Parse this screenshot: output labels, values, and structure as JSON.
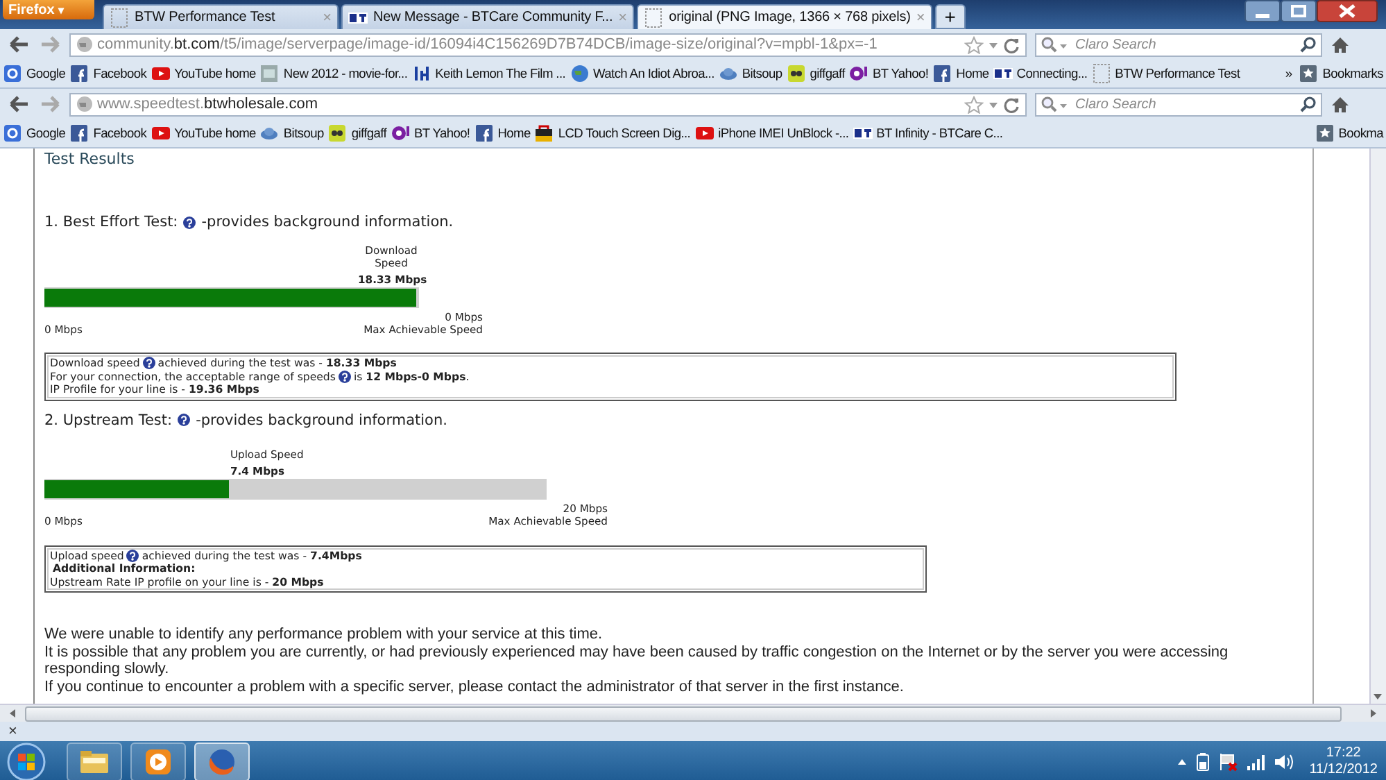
{
  "browser": {
    "menu_button": "Firefox",
    "menu_arrow": "▾",
    "tabs": [
      {
        "title": "BTW Performance Test",
        "close": "×",
        "selected": false
      },
      {
        "title": "New Message - BTCare Community F...",
        "close": "×",
        "selected": false
      },
      {
        "title": "original (PNG Image, 1366 × 768 pixels)",
        "close": "×",
        "selected": true
      }
    ],
    "new_tab": "+"
  },
  "toolbars": [
    {
      "url": "community.**bt.com**/t5/image/serverpage/image-id/16094i4C156269D7B74DCB/image-size/original?v=mpbl-1&px=-1",
      "search_placeholder": "Claro Search",
      "overflow": "»",
      "bookmarks_menu": "Bookmarks",
      "bookmarks": [
        {
          "label": "Google"
        },
        {
          "label": "Facebook"
        },
        {
          "label": "YouTube home"
        },
        {
          "label": "New 2012 - movie-for..."
        },
        {
          "label": "Keith Lemon The Film ..."
        },
        {
          "label": "Watch An Idiot Abroa..."
        },
        {
          "label": "Bitsoup"
        },
        {
          "label": "giffgaff"
        },
        {
          "label": "BT Yahoo!"
        },
        {
          "label": "Home"
        },
        {
          "label": "Connecting..."
        },
        {
          "label": "BTW Performance Test"
        }
      ]
    },
    {
      "url": "www.speedtest.**btwholesale.com**",
      "search_placeholder": "Claro Search",
      "bookmarks_menu": "Bookma",
      "bookmarks": [
        {
          "label": "Google"
        },
        {
          "label": "Facebook"
        },
        {
          "label": "YouTube home"
        },
        {
          "label": "Bitsoup"
        },
        {
          "label": "giffgaff"
        },
        {
          "label": "BT Yahoo!"
        },
        {
          "label": "Home"
        },
        {
          "label": "LCD Touch Screen Dig..."
        },
        {
          "label": "iPhone IMEI UnBlock -..."
        },
        {
          "label": "BT Infinity - BTCare C..."
        }
      ]
    }
  ],
  "page": {
    "title": "Test Results",
    "tests": [
      {
        "heading": "1. Best Effort Test:",
        "note": "-provides background information.",
        "meter": {
          "label": "Download Speed",
          "value": "18.33 Mbps",
          "level": 1,
          "min": "0 Mbps",
          "max": "0 Mbps",
          "max_caption": "Max Achievable Speed"
        },
        "details": [
          {
            "kind": "line",
            "text": "Download speed",
            "help": true,
            "after": "achieved during the test was - **18.33 Mbps**"
          },
          {
            "kind": "line",
            "text": "For your connection, the acceptable range of speeds",
            "help": true,
            "after": "is **12 Mbps-0 Mbps**."
          },
          {
            "kind": "line",
            "text": "IP Profile for your line is - **19.36 Mbps**",
            "help": false
          }
        ]
      },
      {
        "heading": "2. Upstream Test:",
        "note": "-provides background information.",
        "meter": {
          "label": "Upload Speed",
          "value": "7.4 Mbps",
          "level": 0.37,
          "min": "0 Mbps",
          "max": "20 Mbps",
          "max_caption": "Max Achievable Speed"
        },
        "details": [
          {
            "kind": "line",
            "text": "Upload speed",
            "help": true,
            "after": "achieved during the test was - **7.4Mbps**"
          },
          {
            "kind": "heading",
            "text": "Additional Information:"
          },
          {
            "kind": "line",
            "text": "Upstream Rate IP profile on your line is - **20 Mbps**",
            "help": false
          }
        ]
      }
    ],
    "summary": [
      "We were unable to identify any performance problem with your service at this time.",
      "It is possible that any problem you are currently, or had previously experienced may have been caused by traffic congestion on the Internet or by the server you were accessing responding slowly.",
      "If you continue to encounter a problem with a specific server, please contact the administrator of that server in the first instance."
    ]
  },
  "find_bar": {
    "close": "×"
  },
  "taskbar": {
    "apps": [
      {
        "selected": false
      },
      {
        "selected": false
      },
      {
        "selected": true
      }
    ],
    "time": "17:22",
    "date": "11/12/2012"
  }
}
